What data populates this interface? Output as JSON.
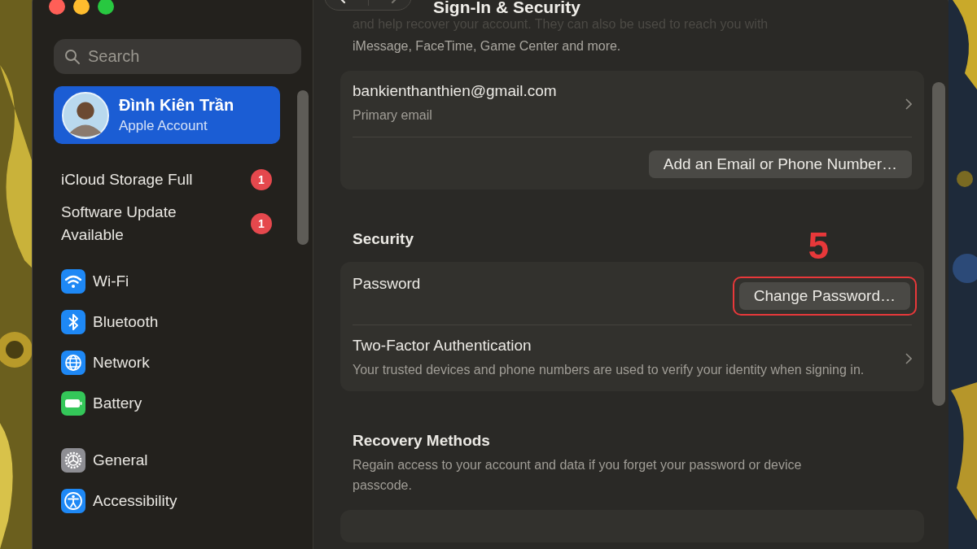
{
  "toolbar": {
    "title": "Sign-In & Security"
  },
  "sidebar": {
    "search": {
      "placeholder": "Search"
    },
    "account": {
      "name": "Đình Kiên Trần",
      "subtitle": "Apple Account",
      "selected": true
    },
    "notices": [
      {
        "label": "iCloud Storage Full",
        "badge": "1",
        "selected": false
      },
      {
        "label": "Software Update Available",
        "badge": "1",
        "selected": false
      }
    ],
    "groups": [
      [
        {
          "label": "Wi-Fi",
          "kind": "wifi",
          "selected": false
        },
        {
          "label": "Bluetooth",
          "kind": "bluetooth",
          "selected": false
        },
        {
          "label": "Network",
          "kind": "network",
          "selected": false
        },
        {
          "label": "Battery",
          "kind": "battery",
          "selected": false
        }
      ],
      [
        {
          "label": "General",
          "kind": "general",
          "selected": false
        },
        {
          "label": "Accessibility",
          "kind": "accessibility",
          "selected": false
        }
      ]
    ]
  },
  "content": {
    "intro_lines": [
      {
        "text": "and help recover your account. They can also be used to reach you with",
        "faded": true
      },
      {
        "text": "iMessage, FaceTime, Game Center and more.",
        "faded": false
      }
    ],
    "email_card": {
      "email": "bankienthanthien@gmail.com",
      "caption": "Primary email",
      "button": "Add an Email or Phone Number…"
    },
    "security": {
      "heading": "Security",
      "rows": [
        {
          "kind": "button",
          "label": "Password",
          "button": "Change Password…",
          "highlighted": true
        },
        {
          "kind": "link",
          "label": "Two-Factor Authentication",
          "description": "Your trusted devices and phone numbers are used to verify your identity when signing in."
        }
      ]
    },
    "recovery": {
      "heading": "Recovery Methods",
      "description": "Regain access to your account and data if you forget your password or device passcode."
    }
  },
  "annotation": {
    "text": "5"
  }
}
